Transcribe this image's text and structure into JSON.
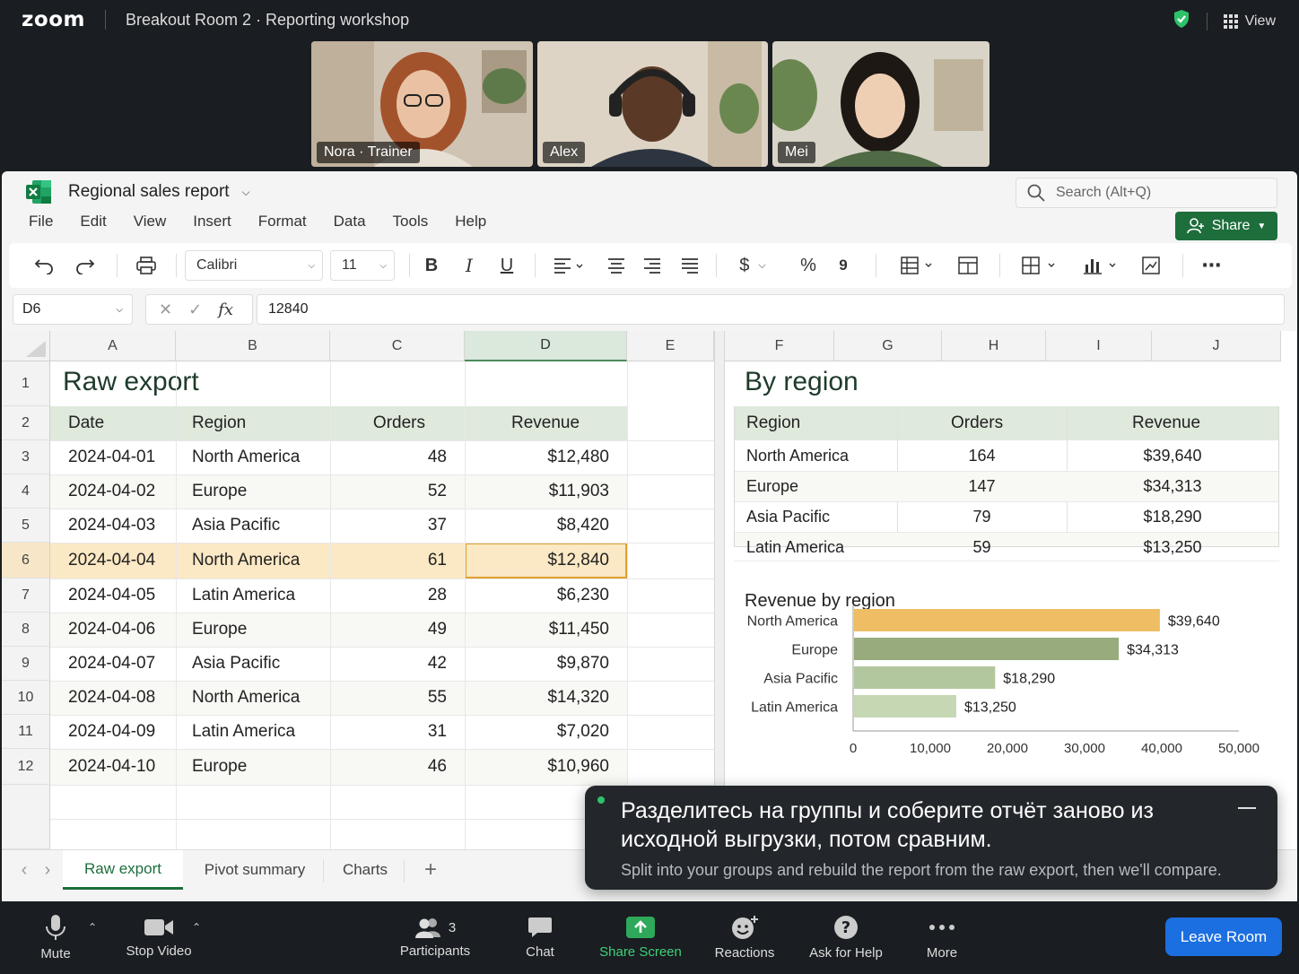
{
  "zoom": {
    "logo": "zoom",
    "room_title": "Breakout Room 2 · Reporting workshop",
    "view_label": "View",
    "participants_tiles": [
      {
        "name": "Nora · Trainer"
      },
      {
        "name": "Alex"
      },
      {
        "name": "Mei"
      }
    ],
    "bottom": {
      "mute": "Mute",
      "stop_video": "Stop Video",
      "participants": "Participants",
      "participants_count": "3",
      "chat": "Chat",
      "share_screen": "Share Screen",
      "reactions": "Reactions",
      "ask_for_help": "Ask for Help",
      "more": "More",
      "leave_room": "Leave Room"
    },
    "colors": {
      "share_green": "#3fd17a",
      "leave_blue": "#1b6fe0",
      "shield_green": "#2ec36a"
    }
  },
  "excel": {
    "doc_title": "Regional sales report",
    "search_placeholder": "Search (Alt+Q)",
    "share_label": "Share",
    "menu": [
      "File",
      "Edit",
      "View",
      "Insert",
      "Format",
      "Data",
      "Tools",
      "Help"
    ],
    "toolbar": {
      "font": "Calibri",
      "size": "11",
      "bold": "B",
      "italic": "I",
      "underline": "U",
      "currency": "$",
      "percent": "%",
      "comma": "9"
    },
    "name_box": "D6",
    "formula_value": "12840",
    "columns": [
      "A",
      "B",
      "C",
      "D",
      "E",
      "F",
      "G",
      "H",
      "I",
      "J"
    ],
    "rows": [
      "1",
      "2",
      "3",
      "4",
      "5",
      "6",
      "7",
      "8",
      "9",
      "10",
      "11",
      "12"
    ],
    "raw": {
      "title": "Raw export",
      "headers": [
        "Date",
        "Region",
        "Orders",
        "Revenue"
      ],
      "data": [
        [
          "2024-04-01",
          "North America",
          "48",
          "$12,480"
        ],
        [
          "2024-04-02",
          "Europe",
          "52",
          "$11,903"
        ],
        [
          "2024-04-03",
          "Asia Pacific",
          "37",
          "$8,420"
        ],
        [
          "2024-04-04",
          "North America",
          "61",
          "$12,840"
        ],
        [
          "2024-04-05",
          "Latin America",
          "28",
          "$6,230"
        ],
        [
          "2024-04-06",
          "Europe",
          "49",
          "$11,450"
        ],
        [
          "2024-04-07",
          "Asia Pacific",
          "42",
          "$9,870"
        ],
        [
          "2024-04-08",
          "North America",
          "55",
          "$14,320"
        ],
        [
          "2024-04-09",
          "Latin America",
          "31",
          "$7,020"
        ],
        [
          "2024-04-10",
          "Europe",
          "46",
          "$10,960"
        ]
      ]
    },
    "by_region": {
      "title": "By region",
      "headers": [
        "Region",
        "Orders",
        "Revenue"
      ],
      "data": [
        [
          "North America",
          "164",
          "$39,640"
        ],
        [
          "Europe",
          "147",
          "$34,313"
        ],
        [
          "Asia Pacific",
          "79",
          "$18,290"
        ],
        [
          "Latin America",
          "59",
          "$13,250"
        ]
      ]
    },
    "tabs": [
      "Raw export",
      "Pivot summary",
      "Charts"
    ],
    "add_tab": "+",
    "accent": "#1e6e3c"
  },
  "chart_data": {
    "type": "bar",
    "orientation": "horizontal",
    "title": "Revenue by region",
    "categories": [
      "North America",
      "Europe",
      "Asia Pacific",
      "Latin America"
    ],
    "values": [
      39640,
      34313,
      18290,
      13250
    ],
    "value_labels": [
      "$39,640",
      "$34,313",
      "$18,290",
      "$13,250"
    ],
    "xlim": [
      0,
      50000
    ],
    "xticks": [
      0,
      10000,
      20000,
      30000,
      40000,
      50000
    ],
    "xtick_labels": [
      "0",
      "10,000",
      "20,000",
      "30,000",
      "40,000",
      "50,000"
    ],
    "colors": [
      "#eebd64",
      "#98ab7c",
      "#b3c79f",
      "#c6d7b4"
    ],
    "grid": false
  },
  "toast": {
    "message_ru": "Разделитесь на группы и соберите отчёт заново из исходной выгрузки, потом сравним.",
    "message_en": "Split into your groups and rebuild the report from the raw export, then we'll compare."
  }
}
